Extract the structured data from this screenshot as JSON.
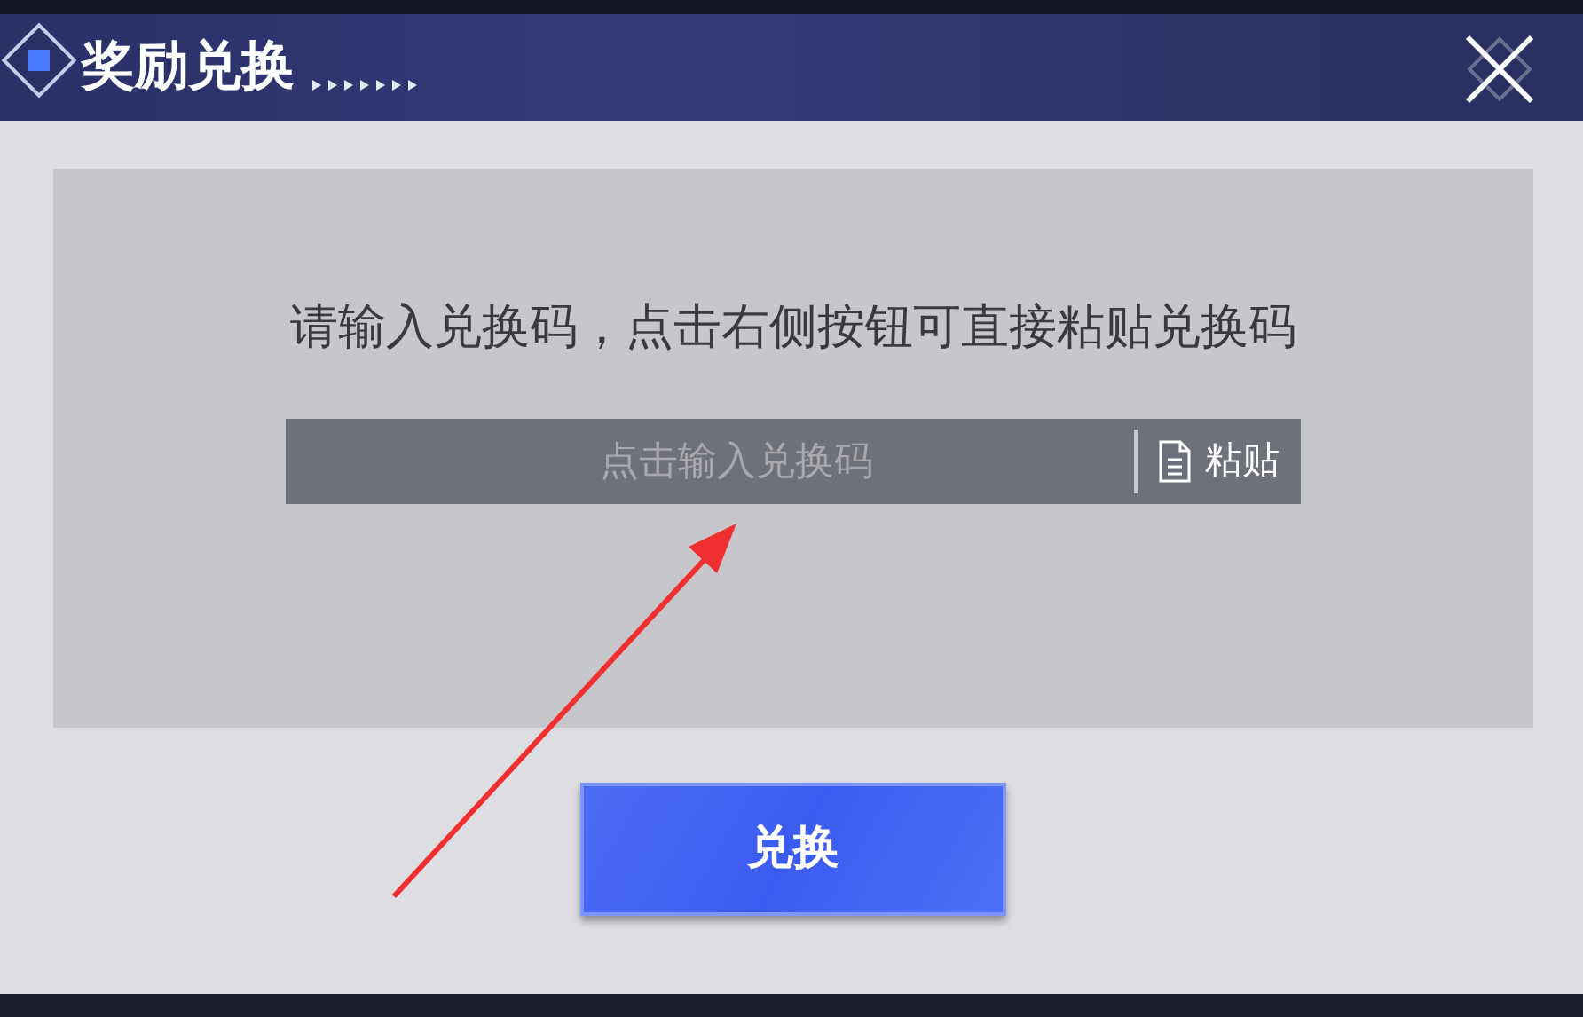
{
  "dialog": {
    "title": "奖励兑换"
  },
  "prompt": "请输入兑换码，点击右侧按钮可直接粘贴兑换码",
  "code_field": {
    "placeholder": "点击输入兑换码"
  },
  "paste_button": {
    "label": "粘贴"
  },
  "redeem_button": {
    "label": "兑换"
  }
}
